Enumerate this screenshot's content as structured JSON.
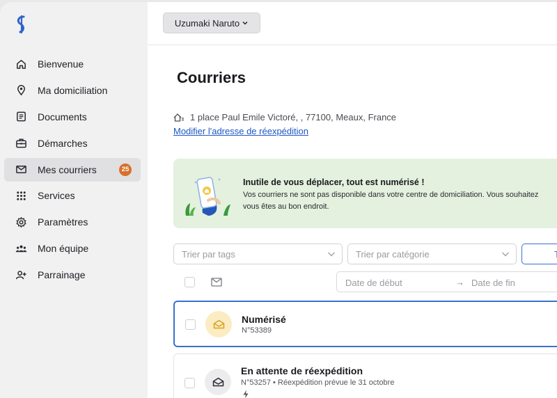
{
  "user": {
    "name": "Uzumaki Naruto"
  },
  "sidebar": {
    "items": [
      {
        "label": "Bienvenue",
        "icon": "home-icon"
      },
      {
        "label": "Ma domiciliation",
        "icon": "location-pin-icon"
      },
      {
        "label": "Documents",
        "icon": "document-icon"
      },
      {
        "label": "Démarches",
        "icon": "briefcase-icon"
      },
      {
        "label": "Mes courriers",
        "icon": "mail-icon",
        "active": true,
        "badge": "25"
      },
      {
        "label": "Services",
        "icon": "grid-icon"
      },
      {
        "label": "Paramètres",
        "icon": "gear-icon"
      },
      {
        "label": "Mon équipe",
        "icon": "team-icon"
      },
      {
        "label": "Parrainage",
        "icon": "user-add-icon"
      }
    ]
  },
  "page": {
    "title": "Courriers",
    "address": "1 place Paul Emile Victoré, , 77100, Meaux, France",
    "edit_link": "Modifier l'adresse de réexpédition"
  },
  "banner": {
    "title": "Inutile de vous déplacer, tout est numérisé !",
    "line1": "Vos courriers ne sont pas disponible dans votre centre de domiciliation. Vous souhaitez",
    "line2": "vous êtes au bon endroit."
  },
  "filters": {
    "tags_placeholder": "Trier par tags",
    "category_placeholder": "Trier par catégorie",
    "button_label": "T",
    "date_start": "Date de début",
    "date_arrow": "→",
    "date_end": "Date de fin"
  },
  "mails": [
    {
      "status": "Numérisé",
      "number": "N°53389",
      "detail": ""
    },
    {
      "status": "En attente de réexpédition",
      "number": "N°53257",
      "detail": " • Réexpédition prévue le 31 octobre"
    }
  ],
  "colors": {
    "accent": "#3a6fd1",
    "badge": "#d8702b",
    "banner_bg": "#e3f1de",
    "scanned_bg": "#fbecc2",
    "scanned_icon": "#d9a21f"
  }
}
